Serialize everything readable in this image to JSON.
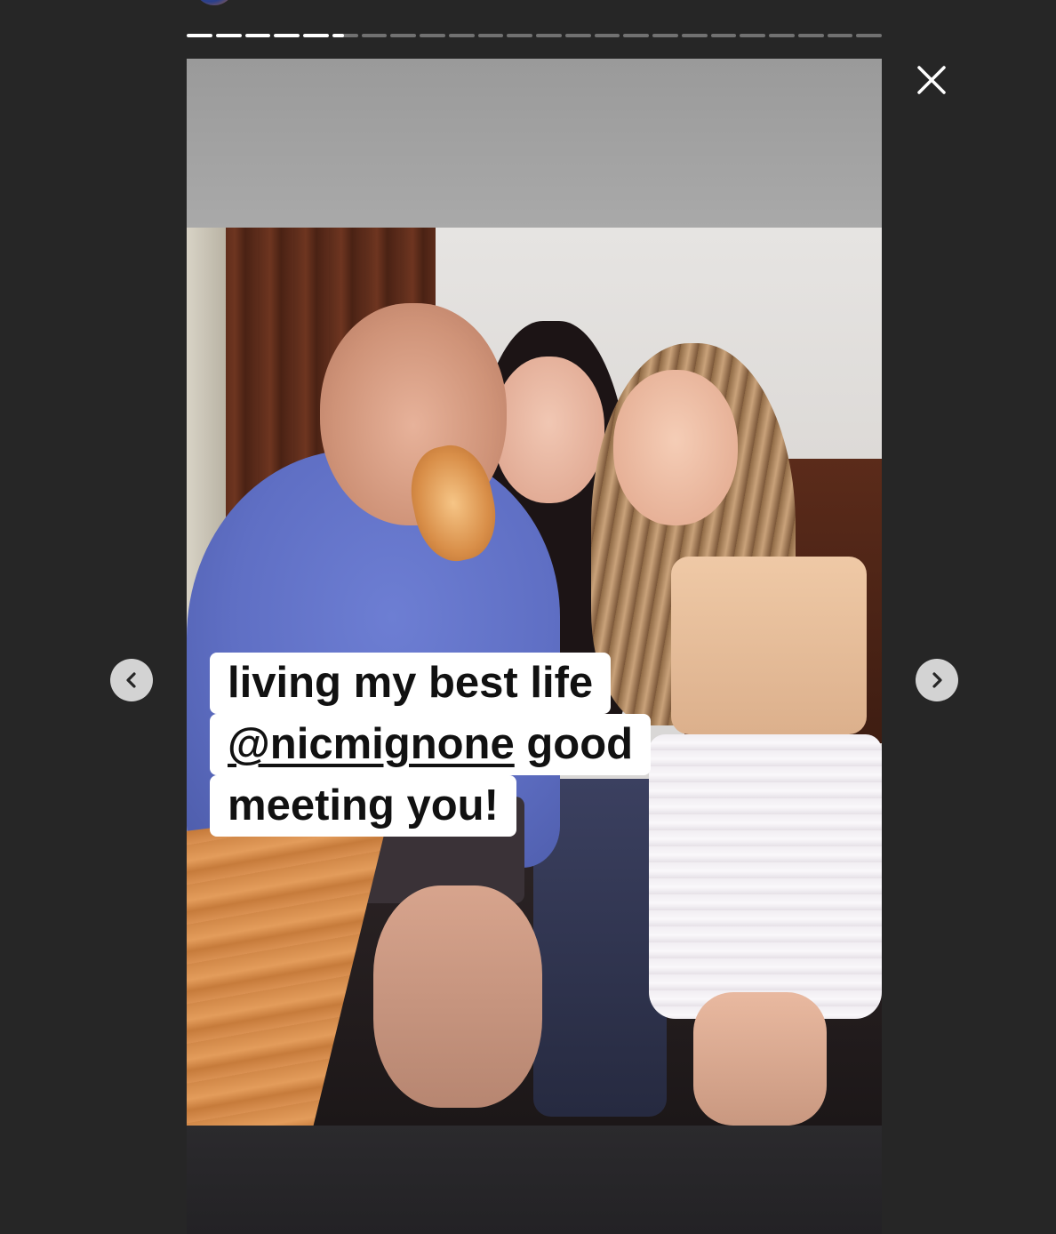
{
  "story": {
    "segments_total": 24,
    "segments_completed": 5,
    "current_segment_progress": 0.45,
    "caption": {
      "line1": "living my best life",
      "line2_mention": "@nicmignone",
      "line2_rest": " good",
      "line3": "meeting you!"
    }
  },
  "controls": {
    "close_icon": "close-icon",
    "prev_icon": "chevron-left-icon",
    "next_icon": "chevron-right-icon"
  },
  "colors": {
    "background": "#262626",
    "progress_active": "#ffffff",
    "progress_inactive": "rgba(255,255,255,0.35)",
    "nav_button_bg": "#ffffffcc"
  }
}
